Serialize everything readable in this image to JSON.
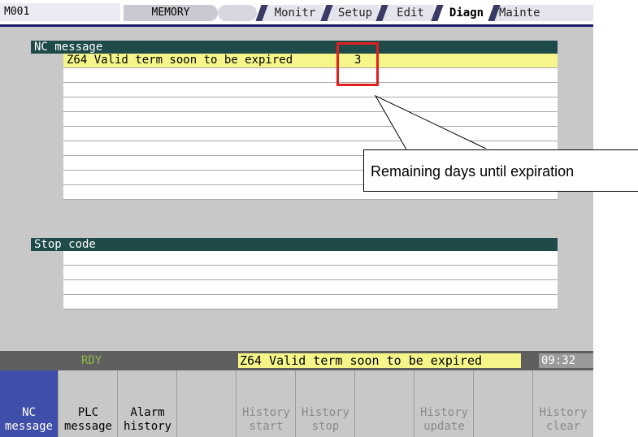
{
  "header": {
    "program": "M001",
    "mode": "MEMORY",
    "tabs": [
      {
        "label": "Monitr",
        "active": false
      },
      {
        "label": "Setup",
        "active": false
      },
      {
        "label": "Edit",
        "active": false
      },
      {
        "label": "Diagn",
        "active": true
      },
      {
        "label": "Mainte",
        "active": false
      }
    ]
  },
  "nc_message": {
    "title": "NC message",
    "rows": [
      {
        "message": "Z64 Valid term soon to be expired",
        "value": "3"
      },
      {
        "message": "",
        "value": ""
      },
      {
        "message": "",
        "value": ""
      },
      {
        "message": "",
        "value": ""
      },
      {
        "message": "",
        "value": ""
      },
      {
        "message": "",
        "value": ""
      },
      {
        "message": "",
        "value": ""
      },
      {
        "message": "",
        "value": ""
      },
      {
        "message": "",
        "value": ""
      },
      {
        "message": "",
        "value": ""
      }
    ]
  },
  "stop_code": {
    "title": "Stop code",
    "rows": [
      {
        "message": ""
      },
      {
        "message": ""
      },
      {
        "message": ""
      },
      {
        "message": ""
      }
    ]
  },
  "callout": {
    "text": "Remaining days until expiration"
  },
  "status": {
    "ready": "RDY",
    "alarm": "Z64 Valid term soon to be expired",
    "time": "09:32"
  },
  "softkeys": [
    {
      "line1": "NC",
      "line2": "message",
      "selected": true,
      "enabled": true
    },
    {
      "line1": "PLC",
      "line2": "message",
      "selected": false,
      "enabled": true
    },
    {
      "line1": "Alarm",
      "line2": "history",
      "selected": false,
      "enabled": true
    },
    {
      "line1": "",
      "line2": "",
      "selected": false,
      "enabled": true
    },
    {
      "line1": "History",
      "line2": "start",
      "selected": false,
      "enabled": false
    },
    {
      "line1": "History",
      "line2": "stop",
      "selected": false,
      "enabled": false
    },
    {
      "line1": "",
      "line2": "",
      "selected": false,
      "enabled": true
    },
    {
      "line1": "History",
      "line2": "update",
      "selected": false,
      "enabled": false
    },
    {
      "line1": "",
      "line2": "",
      "selected": false,
      "enabled": true
    },
    {
      "line1": "History",
      "line2": "clear",
      "selected": false,
      "enabled": false
    }
  ],
  "colors": {
    "section_header": "#1f4a4a",
    "highlight": "#f5f58a",
    "selected_key": "#3f4ea8",
    "callout_box": "#e02020"
  }
}
